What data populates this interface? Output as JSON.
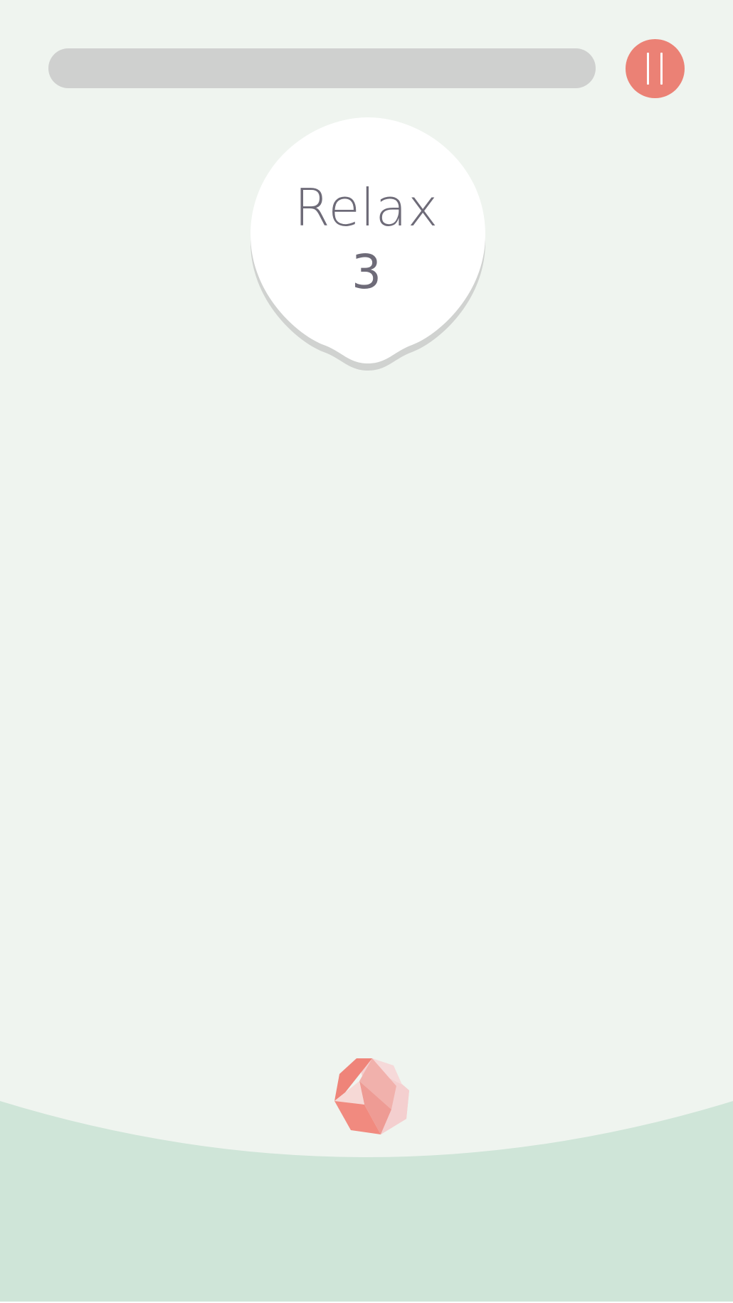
{
  "status": {
    "label": "Relax",
    "count": "3"
  },
  "progress": {
    "value": 0
  },
  "controls": {
    "pause_icon": "pause-icon"
  },
  "player": {
    "icon": "gem-icon"
  },
  "colors": {
    "background": "#eff4ef",
    "ground": "#cfe5d8",
    "accent": "#eb8175",
    "track": "#cfd0cf",
    "text": "#6e6b78"
  }
}
